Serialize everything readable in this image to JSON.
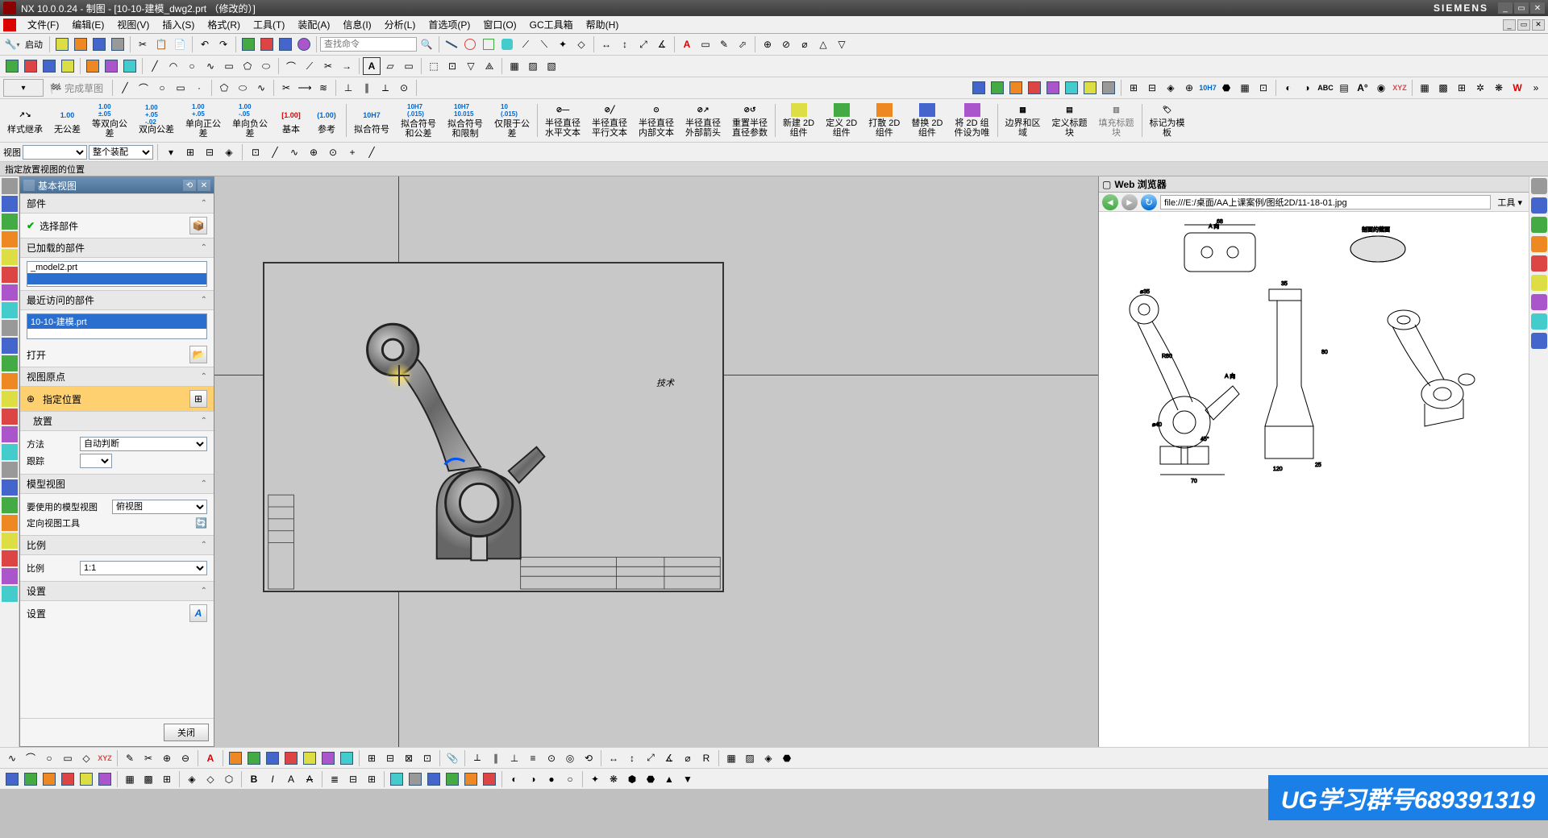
{
  "titlebar": {
    "app": "NX 10.0.0.24",
    "context": "制图",
    "file": "[10-10-建模_dwg2.prt （修改的）]",
    "brand": "SIEMENS"
  },
  "menu": {
    "items": [
      "文件(F)",
      "编辑(E)",
      "视图(V)",
      "插入(S)",
      "格式(R)",
      "工具(T)",
      "装配(A)",
      "信息(I)",
      "分析(L)",
      "首选项(P)",
      "窗口(O)",
      "GC工具箱",
      "帮助(H)"
    ]
  },
  "toolbar1": {
    "start": "启动",
    "search_placeholder": "查找命令"
  },
  "cmdrow": {
    "items": [
      {
        "label": "样式继承",
        "icon": "inherit"
      },
      {
        "label": "无公差",
        "icon": "1.00"
      },
      {
        "label": "等双向公\n差",
        "icon": "1.00\n±.05"
      },
      {
        "label": "双向公差",
        "icon": "1.00\n+.05\n-.02"
      },
      {
        "label": "单向正公\n差",
        "icon": "1.00\n+.05"
      },
      {
        "label": "单向负公\n差",
        "icon": "1.00\n-.05"
      },
      {
        "label": "基本",
        "icon": "[1.00]"
      },
      {
        "label": "参考",
        "icon": "(1.00)"
      },
      {
        "label": "拟合符号",
        "icon": "10H7"
      },
      {
        "label": "拟合符号\n和公差",
        "icon": "10H7\n(.015)"
      },
      {
        "label": "拟合符号\n和限制",
        "icon": "10H7\n10.015"
      },
      {
        "label": "仅限于公\n差",
        "icon": "10\n(.015)"
      },
      {
        "label": "半径直径\n水平文本",
        "icon": "hdiag"
      },
      {
        "label": "半径直径\n平行文本",
        "icon": "pdiag"
      },
      {
        "label": "半径直径\n内部文本",
        "icon": "idiag"
      },
      {
        "label": "半径直径\n外部箭头",
        "icon": "odiag"
      },
      {
        "label": "重置半径\n直径参数",
        "icon": "reset"
      },
      {
        "label": "新建 2D\n组件",
        "icon": "new2d"
      },
      {
        "label": "定义 2D\n组件",
        "icon": "def2d"
      },
      {
        "label": "打散 2D\n组件",
        "icon": "exp2d"
      },
      {
        "label": "替换 2D\n组件",
        "icon": "rep2d"
      },
      {
        "label": "将 2D 组\n件设为唯",
        "icon": "unq2d"
      },
      {
        "label": "边界和区\n域",
        "icon": "bnd"
      },
      {
        "label": "定义标题\n块",
        "icon": "ttl"
      },
      {
        "label": "填充标题\n块",
        "icon": "fill"
      },
      {
        "label": "标记为模\n板",
        "icon": "tmpl"
      }
    ]
  },
  "selbar": {
    "view_label": "视图",
    "assembly": "整个装配"
  },
  "hint": "指定放置视图的位置",
  "dialog": {
    "title": "基本视图",
    "sections": {
      "part": "部件",
      "select_part": "选择部件",
      "loaded": "已加载的部件",
      "loaded_item": "_model2.prt",
      "recent": "最近访问的部件",
      "recent_item": "10-10-建模.prt",
      "open": "打开",
      "origin": "视图原点",
      "specify": "指定位置",
      "placement": "放置",
      "method": "方法",
      "method_val": "自动判断",
      "track": "跟踪",
      "modelview": "模型视图",
      "use_modelview": "要使用的模型视图",
      "modelview_val": "俯视图",
      "orient_tool": "定向视图工具",
      "scale": "比例",
      "scale_label": "比例",
      "scale_val": "1:1",
      "settings": "设置",
      "settings2": "设置"
    },
    "close": "关闭"
  },
  "web": {
    "title": "Web 浏览器",
    "url": "file:///E:/桌面/AA上课案例/图纸2D/11-18-01.jpg",
    "tools": "工具"
  },
  "canvas": {
    "note": "技术"
  },
  "watermark": "UG学习群号689391319"
}
